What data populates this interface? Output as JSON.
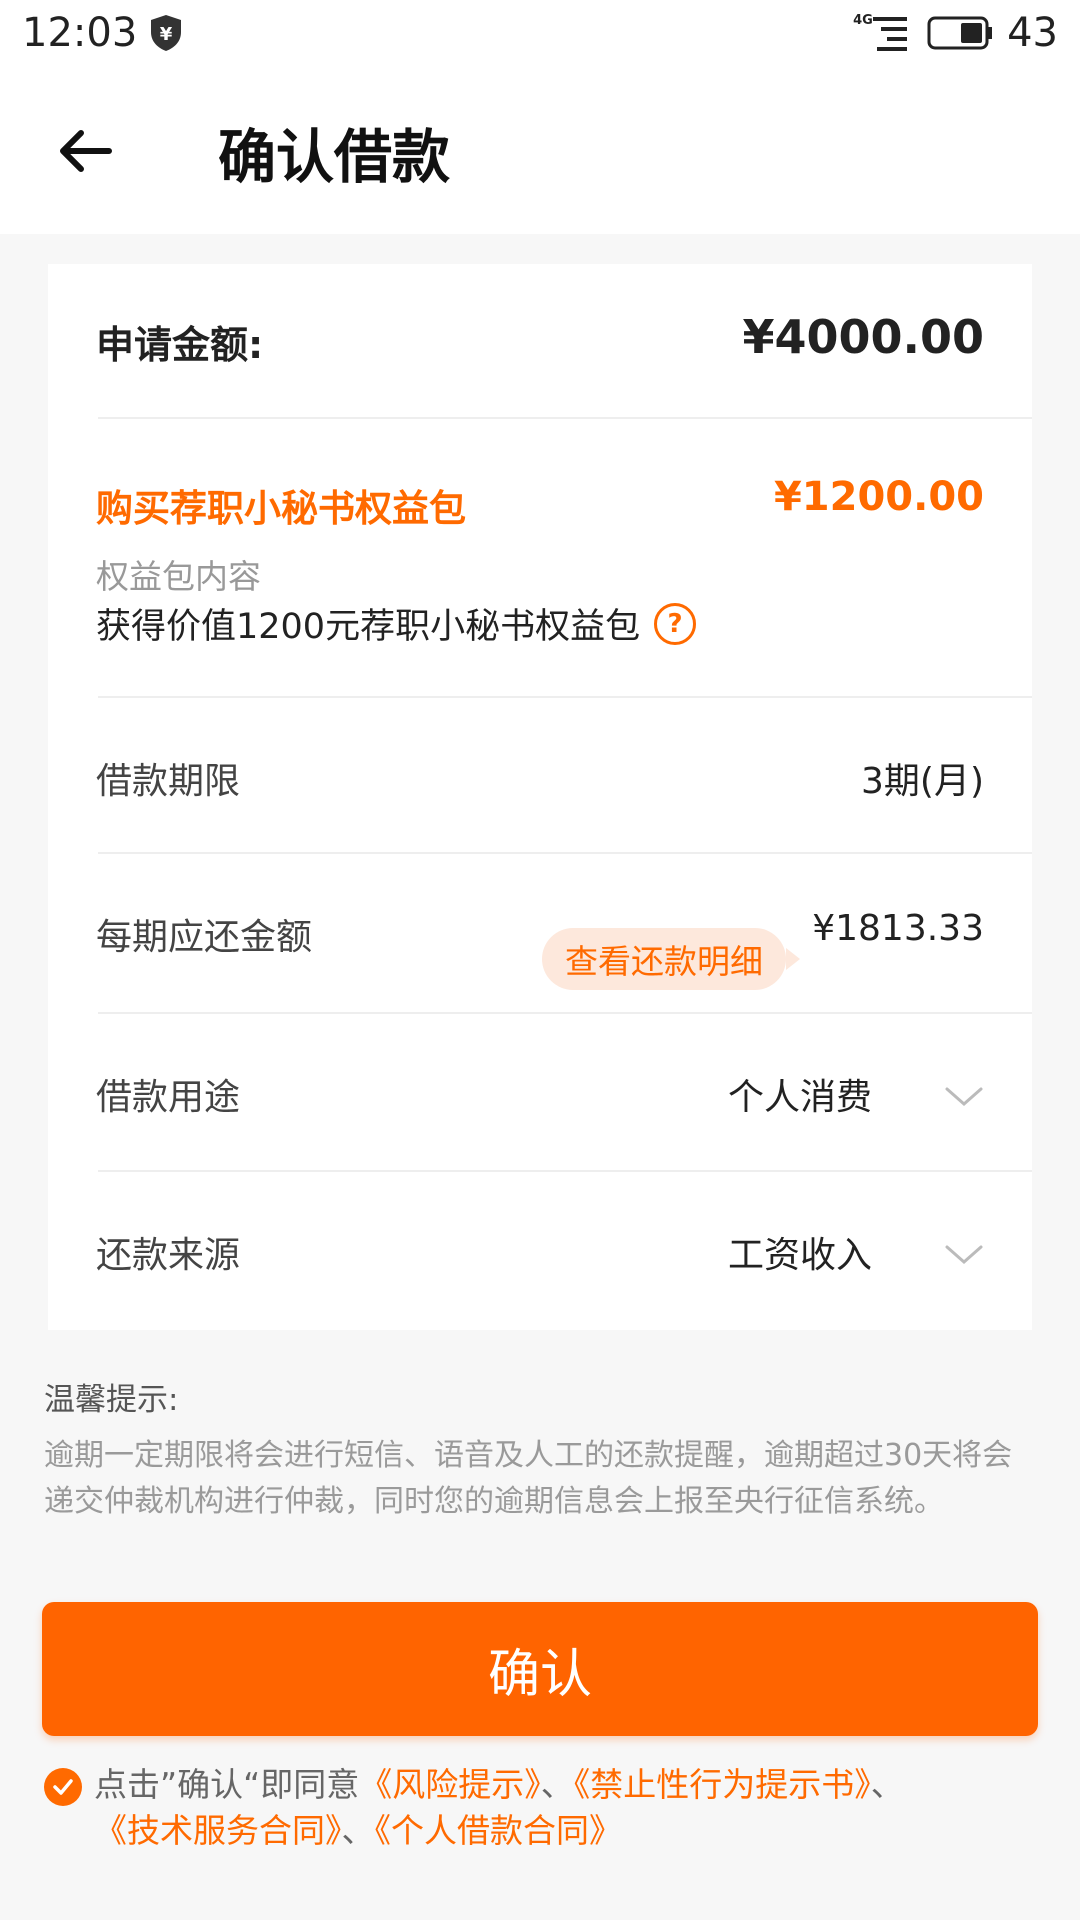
{
  "status_bar": {
    "time": "12:03",
    "network": "4G",
    "battery": "43",
    "icons": [
      "shield-yuan-icon",
      "signal-icon",
      "battery-icon"
    ]
  },
  "header": {
    "back_icon": "arrow-left-icon",
    "title": "确认借款"
  },
  "loan": {
    "amount_label": "申请金额:",
    "amount_value": "¥4000.00",
    "package_title": "购买荐职小秘书权益包",
    "package_price": "¥1200.00",
    "package_content_label": "权益包内容",
    "package_content_desc": "获得价值1200元荐职小秘书权益包",
    "package_help_icon": "?",
    "term_label": "借款期限",
    "term_value": "3期(月)",
    "installment_label": "每期应还金额",
    "installment_detail_button": "查看还款明细",
    "installment_value": "¥1813.33",
    "purpose_label": "借款用途",
    "purpose_value": "个人消费",
    "source_label": "还款来源",
    "source_value": "工资收入"
  },
  "tips": {
    "title": "温馨提示:",
    "body": "逾期一定期限将会进行短信、语音及人工的还款提醒，逾期超过30天将会递交仲裁机构进行仲裁，同时您的逾期信息会上报至央行征信系统。"
  },
  "confirm_button": "确认",
  "agreement": {
    "prefix": "点击”确认“即同意",
    "link1": "《风险提示》",
    "sep1": "、",
    "link2": "《禁止性行为提示书》",
    "sep2": "、",
    "link3": "《技术服务合同》",
    "sep3": "、",
    "link4": "《个人借款合同》"
  },
  "colors": {
    "accent": "#ff6a00",
    "pill_bg": "#fde8dc",
    "page_bg": "#f7f7f7"
  }
}
